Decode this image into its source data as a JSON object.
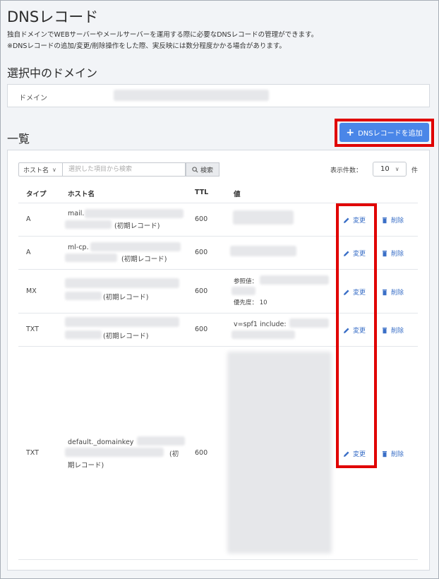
{
  "page": {
    "title": "DNSレコード",
    "description_1": "独自ドメインでWEBサーバーやメールサーバーを運用する際に必要なDNSレコードの管理ができます。",
    "description_2": "※DNSレコードの追加/変更/削除操作をした際、実反映には数分程度かかる場合があります。"
  },
  "domain_section": {
    "title": "選択中のドメイン",
    "label": "ドメイン"
  },
  "list_section": {
    "title": "一覧",
    "add_button": "DNSレコードを追加",
    "add_icon": "plus-icon"
  },
  "toolbar": {
    "host_select": "ホスト名",
    "search_placeholder": "選択した項目から検索",
    "search_button": "検索",
    "perpage_label": "表示件数：",
    "perpage_value": "10",
    "perpage_unit": "件"
  },
  "table": {
    "headers": [
      "タイプ",
      "ホスト名",
      "TTL",
      "値"
    ],
    "edit_label": "変更",
    "delete_label": "削除",
    "rows": [
      {
        "type": "A",
        "host_prefix": "mail.",
        "host_note": "(初期レコード)",
        "ttl": "600"
      },
      {
        "type": "A",
        "host_prefix": "ml-cp.",
        "host_note": "(初期レコード)",
        "ttl": "600"
      },
      {
        "type": "MX",
        "host_prefix": "",
        "host_note": "(初期レコード)",
        "ttl": "600",
        "value_ref": "参照値：",
        "value_priority": "優先度： 10"
      },
      {
        "type": "TXT",
        "host_prefix": "",
        "host_note": "(初期レコード)",
        "ttl": "600",
        "value_prefix": "v=spf1 include:"
      },
      {
        "type": "TXT",
        "host_prefix": "default._domainkey",
        "host_note_a": "(初",
        "host_note_b": "期レコード)",
        "ttl": "600"
      }
    ]
  },
  "colors": {
    "accent": "#4a86e8",
    "link": "#3a6fc7",
    "highlight": "#e00000"
  }
}
